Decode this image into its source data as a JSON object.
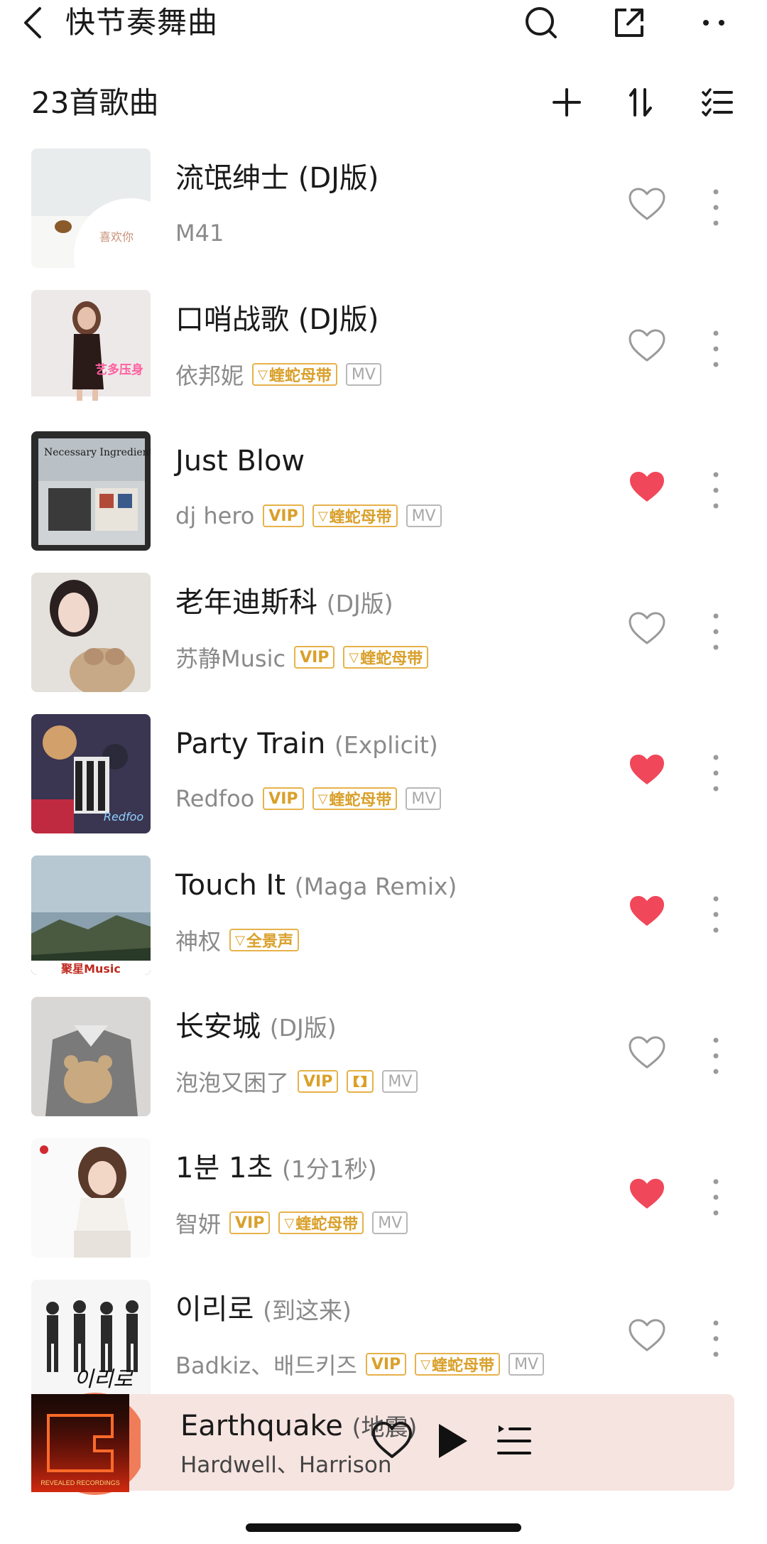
{
  "header": {
    "title": "快节奏舞曲",
    "icons": [
      "back-icon",
      "search-icon",
      "share-icon",
      "more-icon"
    ]
  },
  "list_header": {
    "count_label": "23首歌曲",
    "icons": [
      "add-icon",
      "sort-icon",
      "multi-select-icon"
    ]
  },
  "songs": [
    {
      "title": "流氓绅士 (DJ版)",
      "subtitle": "",
      "artist": "M41",
      "tags": [],
      "liked": false
    },
    {
      "title": "口哨战歌 (DJ版)",
      "subtitle": "",
      "artist": "依邦妮",
      "tags": [
        "蝰蛇母带",
        "MV"
      ],
      "liked": false
    },
    {
      "title": "Just Blow",
      "subtitle": "",
      "artist": "dj hero",
      "tags": [
        "VIP",
        "蝰蛇母带",
        "MV"
      ],
      "liked": true
    },
    {
      "title": "老年迪斯科",
      "subtitle": "(DJ版)",
      "artist": "苏静Music",
      "tags": [
        "VIP",
        "蝰蛇母带"
      ],
      "liked": false
    },
    {
      "title": "Party Train",
      "subtitle": "(Explicit)",
      "artist": "Redfoo",
      "tags": [
        "VIP",
        "蝰蛇母带",
        "MV"
      ],
      "liked": true
    },
    {
      "title": "Touch It",
      "subtitle": "(Maga Remix)",
      "artist": "神权",
      "tags": [
        "全景声"
      ],
      "liked": true
    },
    {
      "title": "长安城",
      "subtitle": "(DJ版)",
      "artist": "泡泡又困了",
      "tags": [
        "VIP",
        "dolby",
        "MV"
      ],
      "liked": false
    },
    {
      "title": "1분 1초",
      "subtitle": "(1分1秒)",
      "artist": "智妍",
      "tags": [
        "VIP",
        "蝰蛇母带",
        "MV"
      ],
      "liked": true
    },
    {
      "title": "이리로",
      "subtitle": "(到这来)",
      "artist": "Badkiz、배드키즈",
      "tags": [
        "VIP",
        "蝰蛇母带",
        "MV"
      ],
      "liked": false
    }
  ],
  "cover_texts": {
    "c1": "喜欢你",
    "c2": "艺多压身",
    "c3": "Necessary Ingredients",
    "c6": "聚星Music",
    "c9": "이리로"
  },
  "player": {
    "title": "Earthquake",
    "subtitle": "(地震)",
    "artist": "Hardwell、Harrison",
    "cover_text": "REVEALED RECORDINGS",
    "icons": [
      "heart-icon",
      "play-icon",
      "playlist-icon"
    ]
  },
  "colors": {
    "liked_red": "#f0475a",
    "tag_gold": "#d9a02a",
    "tag_gray": "#a8a8a8",
    "player_bg": "#f6e4e0"
  }
}
